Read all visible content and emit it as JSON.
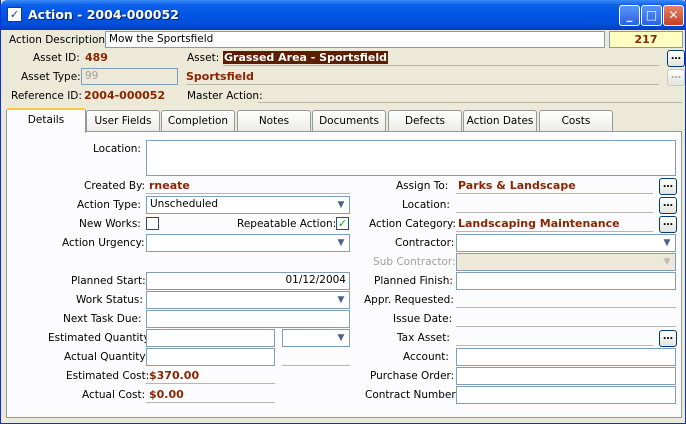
{
  "window": {
    "title": "Action - 2004-000052"
  },
  "header": {
    "action_description_label": "Action Description:",
    "action_description_value": "Mow the Sportsfield",
    "badge": "217",
    "asset_id_label": "Asset ID:",
    "asset_id_value": "489",
    "asset_label": "Asset:",
    "asset_value": "Grassed Area - Sportsfield",
    "asset_type_label": "Asset Type:",
    "asset_type_value": "99",
    "asset_type_name": "Sportsfield",
    "reference_id_label": "Reference ID:",
    "reference_id_value": "2004-000052",
    "master_action_label": "Master Action:"
  },
  "tabs": [
    "Details",
    "User Fields",
    "Completion",
    "Notes",
    "Documents",
    "Defects",
    "Action Dates",
    "Costs"
  ],
  "details": {
    "location_label": "Location:",
    "created_by_label": "Created By:",
    "created_by_value": "rneate",
    "action_type_label": "Action Type:",
    "action_type_value": "Unscheduled",
    "new_works_label": "New Works:",
    "repeatable_label": "Repeatable Action:",
    "action_urgency_label": "Action Urgency:",
    "planned_start_label": "Planned Start:",
    "planned_start_value": "01/12/2004",
    "work_status_label": "Work Status:",
    "next_task_due_label": "Next Task Due:",
    "estimated_quantity_label": "Estimated Quantity:",
    "actual_quantity_label": "Actual Quantity:",
    "estimated_cost_label": "Estimated Cost:",
    "estimated_cost_value": "$370.00",
    "actual_cost_label": "Actual Cost:",
    "actual_cost_value": "$0.00",
    "assign_to_label": "Assign To:",
    "assign_to_value": "Parks & Landscape",
    "location_right_label": "Location:",
    "action_category_label": "Action Category:",
    "action_category_value": "Landscaping Maintenance",
    "contractor_label": "Contractor:",
    "sub_contractor_label": "Sub Contractor:",
    "planned_finish_label": "Planned Finish:",
    "appr_requested_label": "Appr. Requested:",
    "issue_date_label": "Issue Date:",
    "tax_asset_label": "Tax Asset:",
    "account_label": "Account:",
    "purchase_order_label": "Purchase Order:",
    "contract_number_label": "Contract Number:"
  },
  "icons": {
    "dots": "…",
    "dropdown": "▼",
    "check": "✓"
  }
}
